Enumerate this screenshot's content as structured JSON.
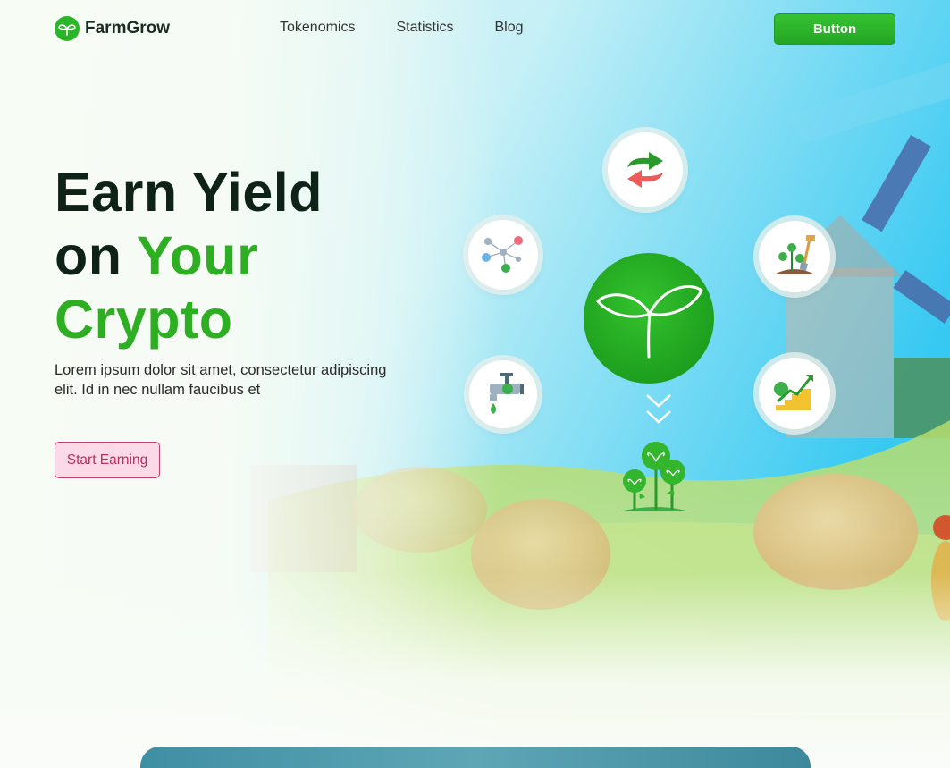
{
  "brand": {
    "name": "FarmGrow",
    "logo_icon": "sprout-icon"
  },
  "nav": {
    "links": [
      "Tokenomics",
      "Statistics",
      "Blog"
    ],
    "button_label": "Button"
  },
  "hero": {
    "title_line1": "Earn Yield",
    "title_line2_plain": "on",
    "title_line2_accent": "Your",
    "title_line3_accent": "Crypto",
    "description": "Lorem ipsum dolor sit amet, consectetur adipiscing elit. Id in nec nullam faucibus et",
    "cta_label": "Start Earning"
  },
  "feature_icons": [
    "swap-arrows-icon",
    "network-users-icon",
    "planting-shovel-icon",
    "watering-tap-icon",
    "growth-coins-icon",
    "sprout-icon",
    "chevron-down-icon",
    "plant-trio-icon"
  ],
  "colors": {
    "brand_green": "#2dae23",
    "cta_pink_bg": "#fbd9e7",
    "cta_pink_text": "#b8305f",
    "title_dark": "#0f2218"
  }
}
